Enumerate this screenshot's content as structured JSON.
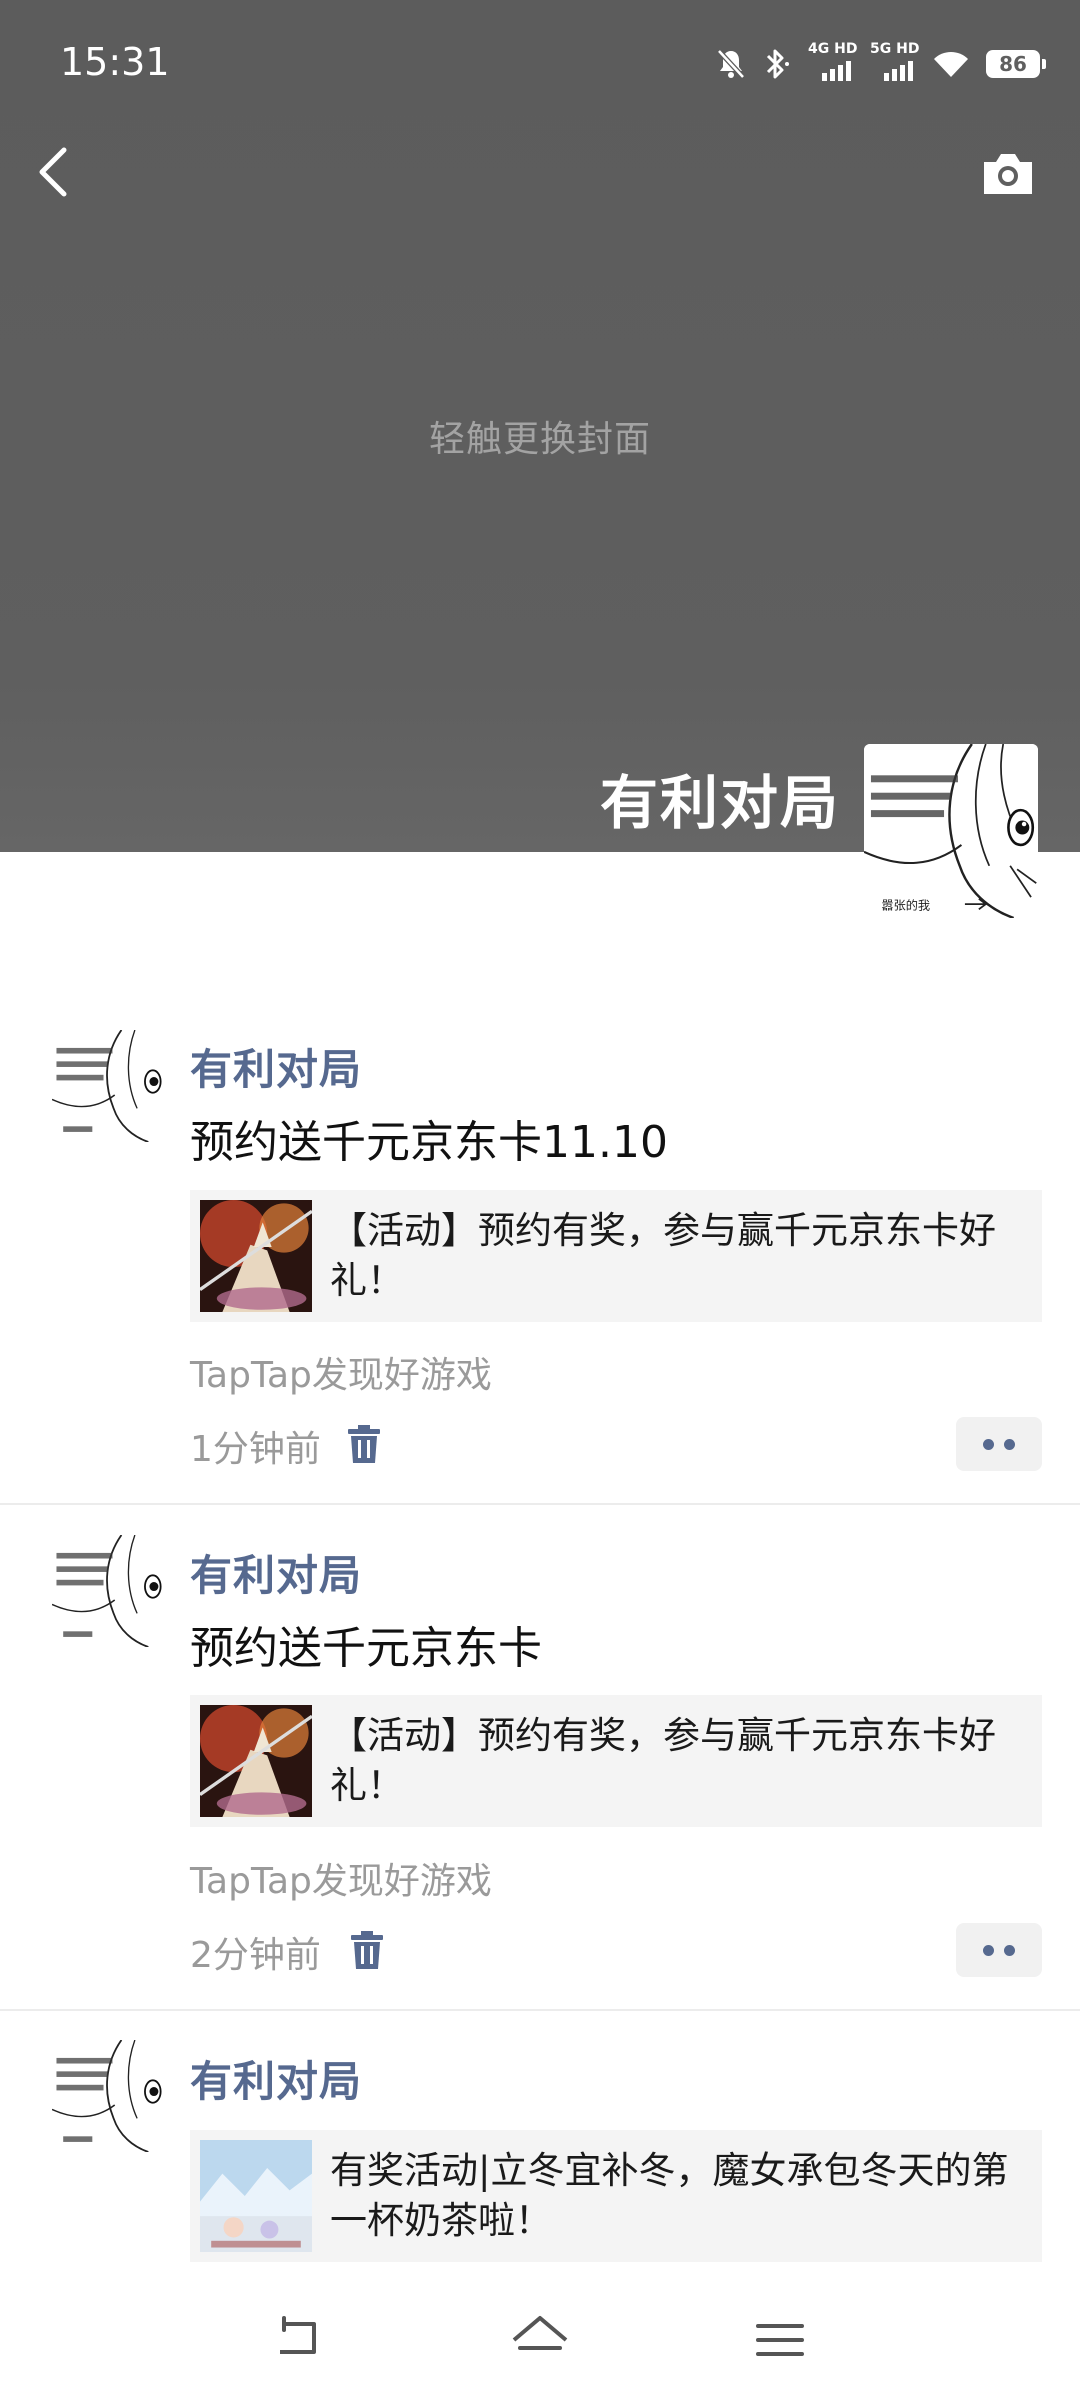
{
  "status_bar": {
    "time": "15:31",
    "signal_1_label": "4G HD",
    "signal_2_label": "5G HD",
    "battery": "86",
    "icons": [
      "mute-icon",
      "bluetooth-icon",
      "signal-icon",
      "signal-icon",
      "wifi-icon",
      "battery-icon"
    ]
  },
  "header": {
    "back_icon": "chevron-left-icon",
    "camera_icon": "camera-icon",
    "cover_hint": "轻触更换封面",
    "profile_name": "有利对局",
    "avatar_caption": "嚣张的我"
  },
  "posts": [
    {
      "author": "有利对局",
      "text": "预约送千元京东卡11.10",
      "card_text": "【活动】预约有奖，参与赢千元京东卡好礼！",
      "source": "TapTap发现好游戏",
      "time": "1分钟前"
    },
    {
      "author": "有利对局",
      "text": "预约送千元京东卡",
      "card_text": "【活动】预约有奖，参与赢千元京东卡好礼！",
      "source": "TapTap发现好游戏",
      "time": "2分钟前"
    },
    {
      "author": "有利对局",
      "card_text": "有奖活动|立冬宜补冬，魔女承包冬天的第一杯奶茶啦！"
    }
  ],
  "nav": {
    "back_icon": "nav-back-icon",
    "home_icon": "home-icon",
    "menu_icon": "menu-icon"
  }
}
